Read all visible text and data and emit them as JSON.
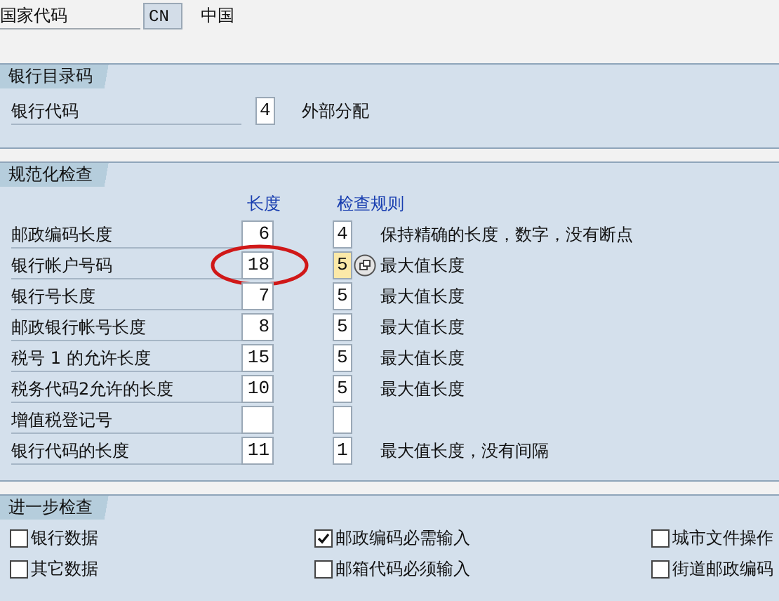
{
  "country": {
    "label": "国家代码",
    "value": "CN",
    "name": "中国"
  },
  "bank_directory": {
    "title": "银行目录码",
    "label": "银行代码",
    "value": "4",
    "description": "外部分配"
  },
  "checks": {
    "title": "规范化检查",
    "column_length": "长度",
    "column_rule": "检查规则",
    "rows": [
      {
        "label": "邮政编码长度",
        "length": "6",
        "rule": "4",
        "description": "保持精确的长度，数字，没有断点",
        "focused": false,
        "circled": false
      },
      {
        "label": "银行帐户号码",
        "length": "18",
        "rule": "5",
        "description": "最大值长度",
        "focused": true,
        "circled": true
      },
      {
        "label": "银行号长度",
        "length": "7",
        "rule": "5",
        "description": "最大值长度",
        "focused": false,
        "circled": false
      },
      {
        "label": "邮政银行帐号长度",
        "length": "8",
        "rule": "5",
        "description": "最大值长度",
        "focused": false,
        "circled": false
      },
      {
        "label": "税号 1 的允许长度",
        "length": "15",
        "rule": "5",
        "description": "最大值长度",
        "focused": false,
        "circled": false
      },
      {
        "label": "税务代码2允许的长度",
        "length": "10",
        "rule": "5",
        "description": "最大值长度",
        "focused": false,
        "circled": false
      },
      {
        "label": "增值税登记号",
        "focused": false,
        "circled": false
      },
      {
        "label": "银行代码的长度",
        "length": "11",
        "rule": "1",
        "description": "最大值长度，没有间隔",
        "focused": false,
        "circled": false
      }
    ]
  },
  "further": {
    "title": "进一步检查",
    "options": [
      {
        "label": "银行数据",
        "checked": false
      },
      {
        "label": "邮政编码必需输入",
        "checked": true
      },
      {
        "label": "城市文件操作",
        "checked": false
      },
      {
        "label": "其它数据",
        "checked": false
      },
      {
        "label": "邮箱代码必须输入",
        "checked": false
      },
      {
        "label": "街道邮政编码",
        "checked": false
      }
    ]
  }
}
